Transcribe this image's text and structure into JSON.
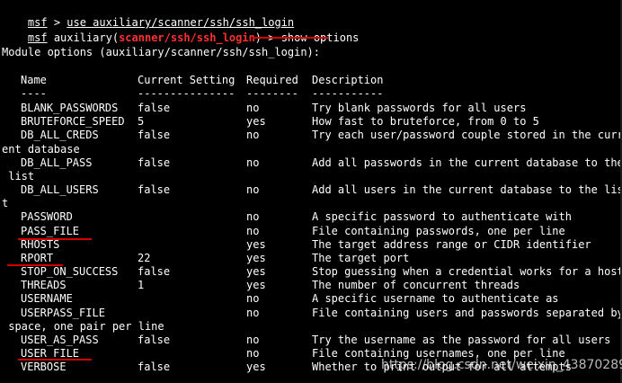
{
  "prompt1": {
    "name": "msf",
    "separator": " > ",
    "command": "use auxiliary/scanner/ssh/ssh_login"
  },
  "prompt2": {
    "name": "msf",
    "module_prefix": " auxiliary(",
    "module": "scanner/ssh/ssh_login",
    "module_suffix": ") > ",
    "command": "show options"
  },
  "heading": "Module options (auxiliary/scanner/ssh/ssh_login):",
  "columns": {
    "name": "Name",
    "current": "Current Setting",
    "required": "Required",
    "description": "Description"
  },
  "rules": {
    "name": "----",
    "current": "---------------",
    "required": "--------",
    "description": "-----------"
  },
  "rows": [
    {
      "name": "BLANK_PASSWORDS",
      "current": "false",
      "required": "no",
      "description": "Try blank passwords for all users"
    },
    {
      "name": "BRUTEFORCE_SPEED",
      "current": "5",
      "required": "yes",
      "description": "How fast to bruteforce, from 0 to 5"
    },
    {
      "name": "DB_ALL_CREDS",
      "current": "false",
      "required": "no",
      "description": "Try each user/password couple stored in the curr"
    },
    {
      "wrap": "ent database"
    },
    {
      "name": "DB_ALL_PASS",
      "current": "false",
      "required": "no",
      "description": "Add all passwords in the current database to the"
    },
    {
      "wrap": " list"
    },
    {
      "name": "DB_ALL_USERS",
      "current": "false",
      "required": "no",
      "description": "Add all users in the current database to the lis"
    },
    {
      "wrap": "t"
    },
    {
      "name": "PASSWORD",
      "current": "",
      "required": "no",
      "description": "A specific password to authenticate with"
    },
    {
      "name": "PASS_FILE",
      "current": "",
      "required": "no",
      "description": "File containing passwords, one per line"
    },
    {
      "name": "RHOSTS",
      "current": "",
      "required": "yes",
      "description": "The target address range or CIDR identifier"
    },
    {
      "name": "RPORT",
      "current": "22",
      "required": "yes",
      "description": "The target port"
    },
    {
      "name": "STOP_ON_SUCCESS",
      "current": "false",
      "required": "yes",
      "description": "Stop guessing when a credential works for a host"
    },
    {
      "name": "THREADS",
      "current": "1",
      "required": "yes",
      "description": "The number of concurrent threads"
    },
    {
      "name": "USERNAME",
      "current": "",
      "required": "no",
      "description": "A specific username to authenticate as"
    },
    {
      "name": "USERPASS_FILE",
      "current": "",
      "required": "no",
      "description": "File containing users and passwords separated by"
    },
    {
      "wrap": " space, one pair per line"
    },
    {
      "name": "USER_AS_PASS",
      "current": "false",
      "required": "no",
      "description": "Try the username as the password for all users"
    },
    {
      "name": "USER_FILE",
      "current": "",
      "required": "no",
      "description": "File containing usernames, one per line"
    },
    {
      "name": "VERBOSE",
      "current": "false",
      "required": "yes",
      "description": "Whether to print output for all attempts"
    }
  ],
  "watermark": "https://blog.csdn.net/weixin_43870289",
  "colors": {
    "background": "#000000",
    "text": "#ffffff",
    "module": "#ff3030",
    "annotation": "#d40000"
  }
}
